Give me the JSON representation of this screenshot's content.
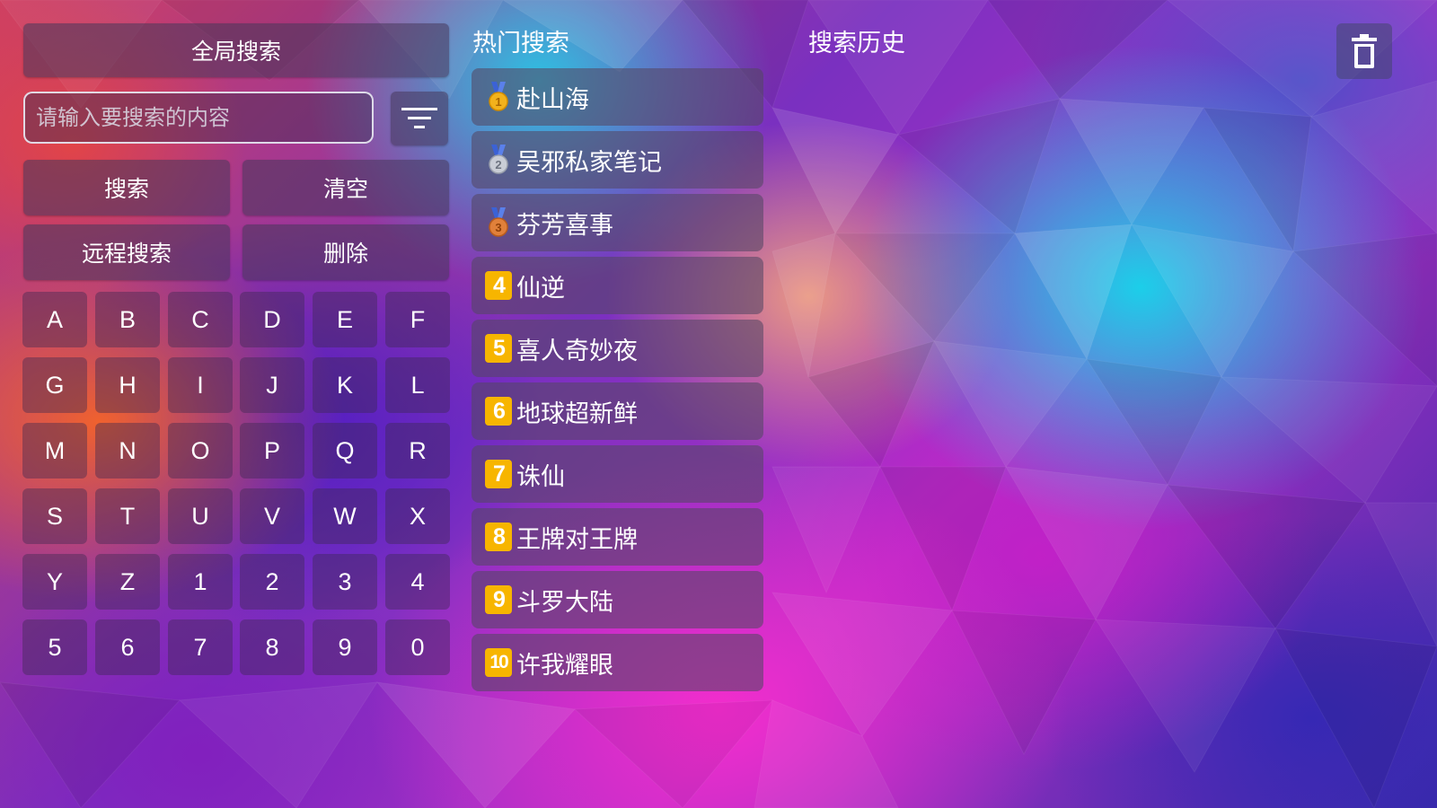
{
  "colors": {
    "rank_badge": "#f7b500",
    "gold": "#f2b21c",
    "silver": "#c9cdd6",
    "bronze": "#e0803a",
    "medal_ribbon": "#3b62d6"
  },
  "left_panel": {
    "global_search_label": "全局搜索",
    "search_placeholder": "请输入要搜索的内容",
    "search_value": "",
    "filter_icon": "filter-icon",
    "search_label": "搜索",
    "clear_label": "清空",
    "remote_search_label": "远程搜索",
    "delete_label": "删除",
    "keys": [
      "A",
      "B",
      "C",
      "D",
      "E",
      "F",
      "G",
      "H",
      "I",
      "J",
      "K",
      "L",
      "M",
      "N",
      "O",
      "P",
      "Q",
      "R",
      "S",
      "T",
      "U",
      "V",
      "W",
      "X",
      "Y",
      "Z",
      "1",
      "2",
      "3",
      "4",
      "5",
      "6",
      "7",
      "8",
      "9",
      "0"
    ]
  },
  "hot_search": {
    "title": "热门搜索",
    "items": [
      {
        "rank": "1",
        "badge": "gold-medal-icon",
        "title": "赴山海"
      },
      {
        "rank": "2",
        "badge": "silver-medal-icon",
        "title": "吴邪私家笔记"
      },
      {
        "rank": "3",
        "badge": "bronze-medal-icon",
        "title": "芬芳喜事"
      },
      {
        "rank": "4",
        "badge": "number",
        "title": "仙逆"
      },
      {
        "rank": "5",
        "badge": "number",
        "title": "喜人奇妙夜"
      },
      {
        "rank": "6",
        "badge": "number",
        "title": "地球超新鲜"
      },
      {
        "rank": "7",
        "badge": "number",
        "title": "诛仙"
      },
      {
        "rank": "8",
        "badge": "number",
        "title": "王牌对王牌"
      },
      {
        "rank": "9",
        "badge": "number",
        "title": "斗罗大陆"
      },
      {
        "rank": "10",
        "badge": "number",
        "title": "许我耀眼"
      }
    ]
  },
  "history": {
    "title": "搜索历史",
    "trash_icon": "trash-icon"
  }
}
